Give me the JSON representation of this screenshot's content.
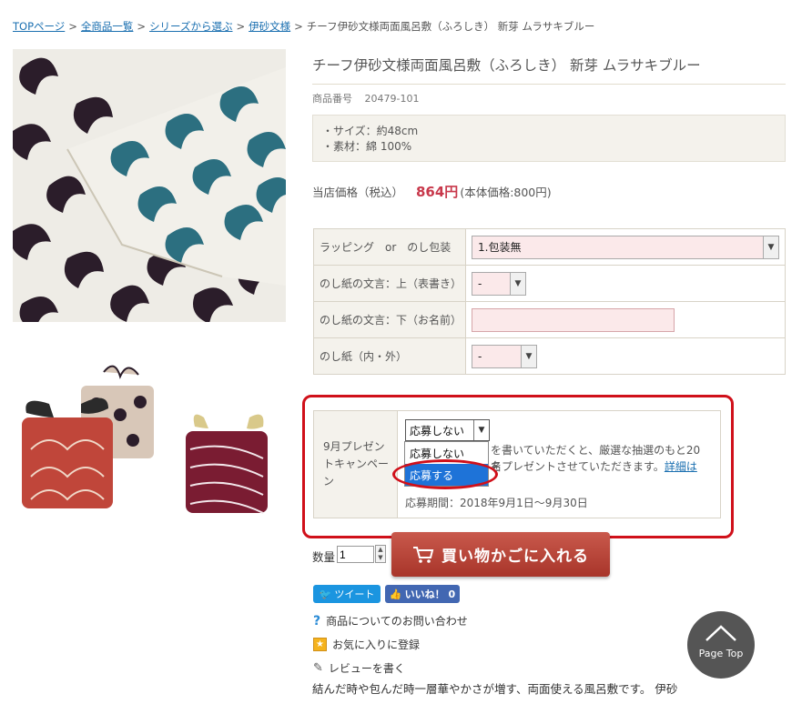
{
  "breadcrumb": {
    "items": [
      "TOPページ",
      "全商品一覧",
      "シリーズから選ぶ",
      "伊砂文様"
    ],
    "current": "チーフ伊砂文様両面風呂敷（ふろしき） 新芽 ムラサキブルー",
    "separator": ">"
  },
  "product": {
    "title": "チーフ伊砂文様両面風呂敷（ふろしき） 新芽 ムラサキブルー",
    "sku_label": "商品番号",
    "sku": "20479-101",
    "spec_lines": [
      "・サイズ：約48cm",
      "・素材：綿 100%"
    ],
    "price_label": "当店価格（税込）",
    "price": "864円",
    "price_note": "(本体価格:800円)"
  },
  "options": {
    "wrapping_label": "ラッピング　or　のし包装",
    "wrapping_value": "1.包装無",
    "noshi_top_label": "のし紙の文言：上（表書き）",
    "noshi_top_value": "-",
    "noshi_bottom_label": "のし紙の文言：下（お名前）",
    "noshi_bottom_value": "",
    "noshi_type_label": "のし紙（内・外）",
    "noshi_type_value": "-"
  },
  "campaign": {
    "label": "9月プレゼントキャンペーン",
    "select_value": "応募しない",
    "dropdown_options": [
      "応募しない",
      "応募する"
    ],
    "text1": "を書いていただくと、厳選な抽選のもと20名",
    "text2": "をプレゼントさせていただきます。",
    "details_link": "詳細は",
    "period": "応募期間：2018年9月1日～9月30日"
  },
  "cart": {
    "qty_label": "数量",
    "qty_value": "1",
    "button_label": "買い物かごに入れる"
  },
  "social": {
    "tweet": "ツイート",
    "like": "いいね！ 0"
  },
  "links": {
    "inquiry": "商品についてのお問い合わせ",
    "favorite": "お気に入りに登録",
    "review": "レビューを書く"
  },
  "description": "結んだ時や包んだ時一層華やかさが増す、両面使える風呂敷です。 伊砂",
  "page_top": "Page Top",
  "colors": {
    "price": "#c8384b",
    "cart_button": "#b5443a",
    "link": "#1a6fb0",
    "highlight": "#d0101a",
    "tweet": "#1b95e0",
    "like": "#4267b2"
  }
}
